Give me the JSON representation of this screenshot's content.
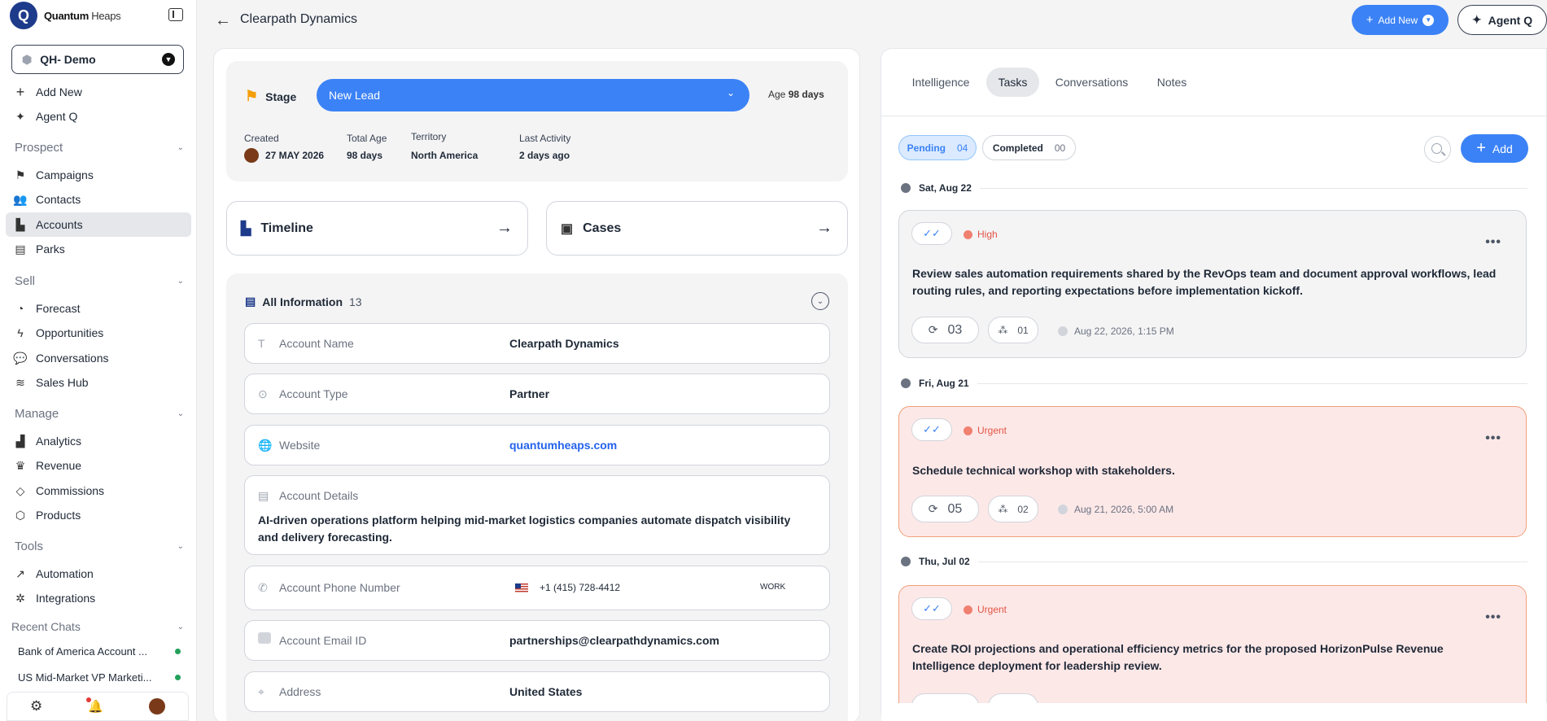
{
  "brand": {
    "name_bold": "Quantum",
    "name_rest": " Heaps"
  },
  "workspace": {
    "label": "QH- Demo"
  },
  "sidebar": {
    "quick": [
      "Add New",
      "Agent Q"
    ],
    "prospect_title": "Prospect",
    "prospect": [
      "Campaigns",
      "Contacts",
      "Accounts",
      "Parks"
    ],
    "sell_title": "Sell",
    "sell": [
      "Forecast",
      "Opportunities",
      "Conversations",
      "Sales Hub"
    ],
    "manage_title": "Manage",
    "manage": [
      "Analytics",
      "Revenue",
      "Commissions",
      "Products"
    ],
    "tools_title": "Tools",
    "tools": [
      "Automation",
      "Integrations"
    ],
    "recent_title": "Recent Chats",
    "recent": [
      "Bank of America Account ...",
      "US Mid-Market VP Marketi..."
    ]
  },
  "header": {
    "title": "Clearpath Dynamics",
    "add_new": "Add New",
    "agent": "Agent Q"
  },
  "stage": {
    "label": "Stage",
    "value": "New Lead",
    "age_label": "Age",
    "age_value": "98 days",
    "created_label": "Created",
    "created_value": "27 MAY 2026",
    "total_age_label": "Total Age",
    "total_age_value": "98 days",
    "territory_label": "Territory",
    "territory_value": "North America",
    "last_activity_label": "Last Activity",
    "last_activity_value": "2 days ago"
  },
  "cards": {
    "timeline": "Timeline",
    "cases": "Cases"
  },
  "info": {
    "title": "All Information",
    "count": "13",
    "account_name_label": "Account Name",
    "account_name": "Clearpath Dynamics",
    "account_type_label": "Account Type",
    "account_type": "Partner",
    "website_label": "Website",
    "website": "quantumheaps.com",
    "details_label": "Account Details",
    "details": "AI-driven operations platform helping mid-market logistics companies automate dispatch visibility and delivery forecasting.",
    "phone_label": "Account Phone Number",
    "phone": "+1 (415) 728-4412",
    "phone_type": "WORK",
    "email_label": "Account Email ID",
    "email": "partnerships@clearpathdynamics.com",
    "address_label": "Address",
    "address": "United States"
  },
  "tabs": [
    "Intelligence",
    "Tasks",
    "Conversations",
    "Notes"
  ],
  "filters": {
    "pending": "Pending",
    "pending_count": "04",
    "completed": "Completed",
    "completed_count": "00",
    "add": "Add"
  },
  "tasks": [
    {
      "date": "Sat, Aug 22",
      "priority": "High",
      "text": "Review sales automation requirements shared by the RevOps team and document approval workflows, lead routing rules, and reporting expectations before implementation kickoff.",
      "subtasks": "03",
      "assignees": "01",
      "due": "Aug 22, 2026, 1:15 PM"
    },
    {
      "date": "Fri, Aug 21",
      "priority": "Urgent",
      "text": "Schedule technical workshop with stakeholders.",
      "subtasks": "05",
      "assignees": "02",
      "due": "Aug 21, 2026, 5:00 AM"
    },
    {
      "date": "Thu, Jul 02",
      "priority": "Urgent",
      "text": "Create ROI projections and operational efficiency metrics for the proposed HorizonPulse Revenue Intelligence deployment for leadership review.",
      "subtasks": "",
      "assignees": "",
      "due": ""
    }
  ],
  "colors": {
    "accent": "#3b82f6",
    "urgent_bg": "#fde8e8",
    "urgent_border": "#f0a07a",
    "priority": "#e25544"
  }
}
